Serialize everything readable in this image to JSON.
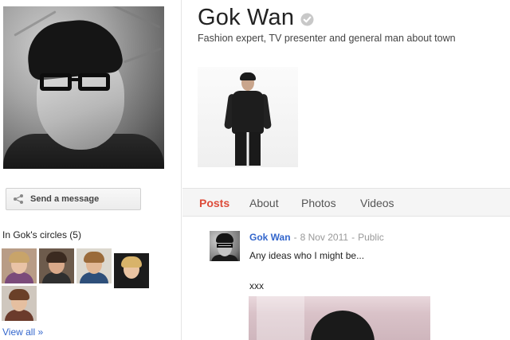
{
  "profile": {
    "name": "Gok Wan",
    "tagline": "Fashion expert, TV presenter and general man about town"
  },
  "actions": {
    "send_message_label": "Send a message"
  },
  "circles": {
    "title": "In Gok's circles (5)",
    "view_all_label": "View all »",
    "members": [
      {
        "hair": "#c8a46a",
        "skin": "#e9c3a6",
        "shirt": "#7b4b7a",
        "bg": "#b89c86"
      },
      {
        "hair": "#3b2a20",
        "skin": "#d9a98a",
        "shirt": "#2f2f2f",
        "bg": "#6d5b4c"
      },
      {
        "hair": "#9a6a3a",
        "skin": "#e2b896",
        "shirt": "#2e4f7a",
        "bg": "#dcd8cf"
      },
      {
        "hair": "#d8b36a",
        "skin": "#eac4a2",
        "shirt": "#1a1a1a",
        "bg": "#1c1c1c"
      },
      {
        "hair": "#6a4028",
        "skin": "#e5bfa0",
        "shirt": "#6b3b2c",
        "bg": "#cfc7be"
      }
    ]
  },
  "tabs": {
    "posts": "Posts",
    "about": "About",
    "photos": "Photos",
    "videos": "Videos",
    "active": "posts"
  },
  "post": {
    "author": "Gok Wan",
    "separator": "-",
    "date": "8 Nov 2011",
    "visibility": "Public",
    "text": "Any ideas who I might be...",
    "text_2": "xxx"
  },
  "colors": {
    "accent_red": "#dd4b39",
    "link_blue": "#3366cc",
    "meta_grey": "#999999"
  },
  "icons": {
    "verified": "verified-check-icon",
    "share": "share-icon"
  }
}
